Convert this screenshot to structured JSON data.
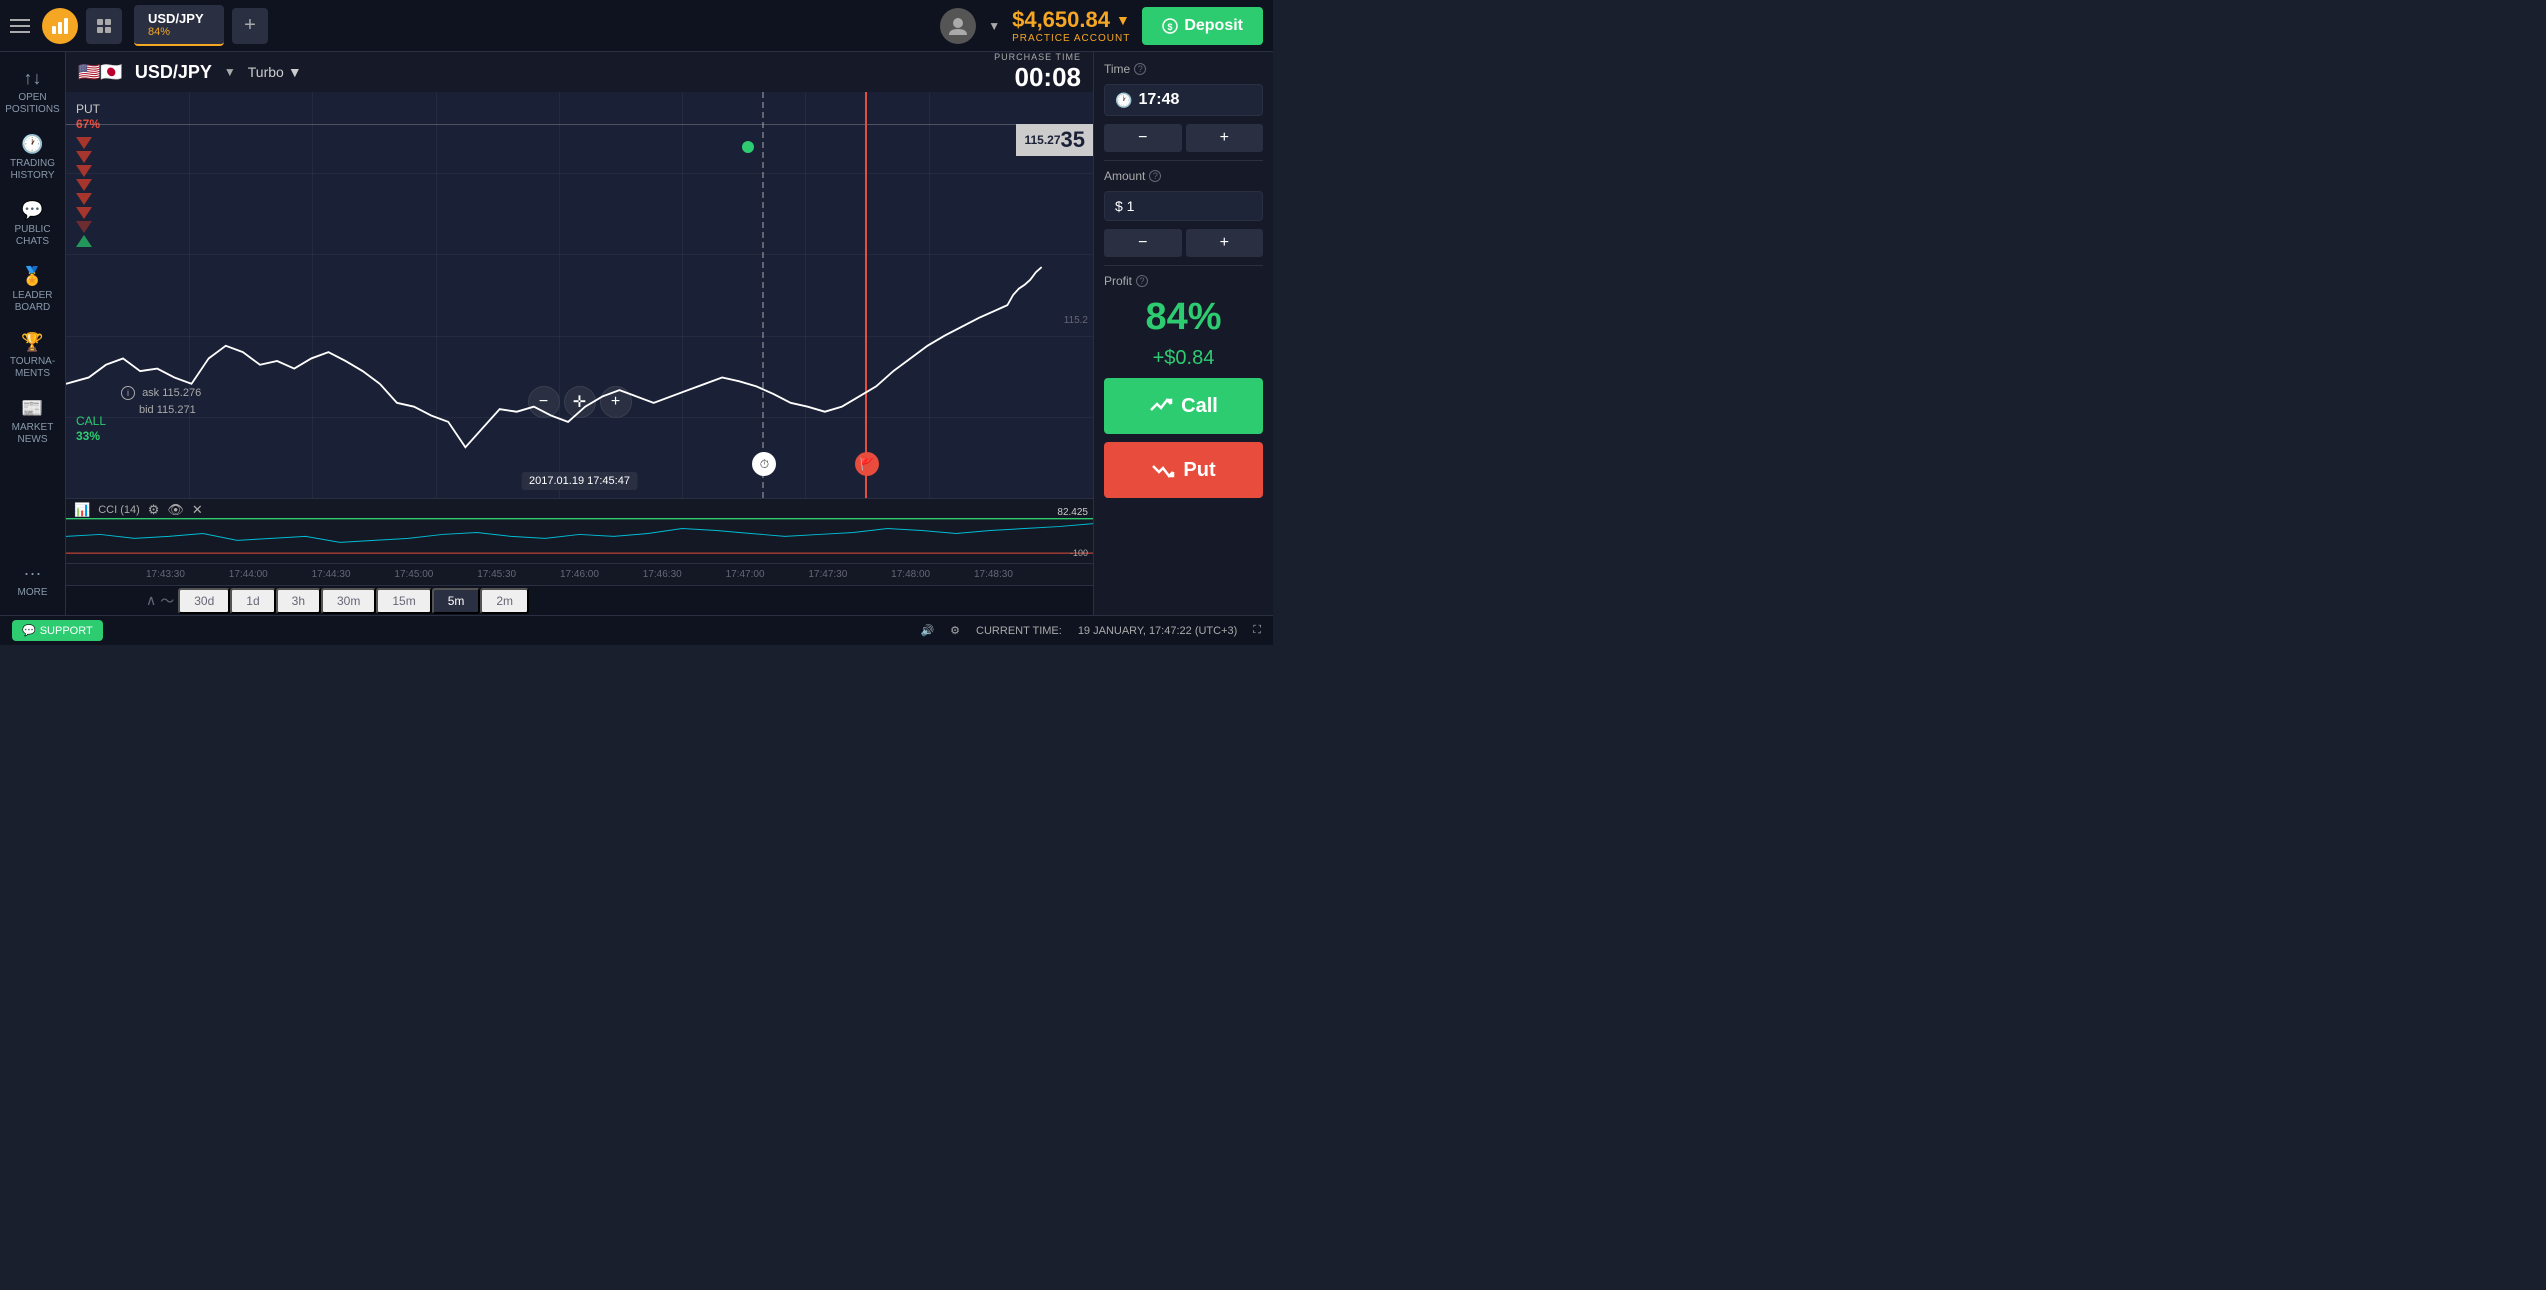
{
  "topnav": {
    "logo_alt": "IQ Option Logo",
    "pair_tab": {
      "name": "USD/JPY",
      "pct": "84%"
    },
    "add_tab_label": "+",
    "balance": "$4,650.84",
    "balance_arrow": "▼",
    "practice_label": "PRACTICE ACCOUNT",
    "deposit_label": "Deposit"
  },
  "sidebar": {
    "items": [
      {
        "id": "open-positions",
        "icon": "↑↓",
        "label": "OPEN\nPOSITIONS"
      },
      {
        "id": "trading-history",
        "icon": "🕐",
        "label": "TRADING\nHISTORY"
      },
      {
        "id": "public-chats",
        "icon": "💬",
        "label": "PUBLIC\nCHATS"
      },
      {
        "id": "leaderboard",
        "icon": "🏅",
        "label": "LEADER\nBOARD"
      },
      {
        "id": "tournaments",
        "icon": "🏆",
        "label": "TOURNA-\nMENTS"
      },
      {
        "id": "market-news",
        "icon": "📰",
        "label": "MARKET\nNEWS"
      },
      {
        "id": "more",
        "icon": "···",
        "label": "MORE"
      }
    ]
  },
  "chart": {
    "pair": "USD/JPY",
    "trade_type": "Turbo",
    "put_label": "PUT",
    "put_pct": "67%",
    "call_label": "CALL",
    "call_pct": "33%",
    "purchase_time_label": "PURCHASE TIME",
    "countdown": "00:08",
    "ask": "115.276",
    "bid": "115.271",
    "price_display": "115.27",
    "price_big": "35",
    "price_115_2": "115.2",
    "date_tooltip": "2017.01.19 17:45:47",
    "cci_label": "CCI (14)",
    "cci_value": "82.425",
    "cci_neg": "-100",
    "time_axis": [
      "17:43:30",
      "17:44:00",
      "17:44:30",
      "17:45:00",
      "17:45:30",
      "17:46:00",
      "17:46:30",
      "17:47:00",
      "17:47:30",
      "17:48:00",
      "17:48:30"
    ]
  },
  "timeframes": {
    "items": [
      "30d",
      "1d",
      "3h",
      "30m",
      "15m",
      "5m",
      "2m"
    ],
    "active": "5m"
  },
  "right_panel": {
    "time_label": "Time",
    "time_value": "17:48",
    "minus": "−",
    "plus": "+",
    "amount_label": "Amount",
    "amount_value": "$ 1",
    "profit_label": "Profit",
    "profit_pct": "84%",
    "profit_dollar": "+$0.84",
    "call_btn": "Call",
    "put_btn": "Put"
  },
  "status_bar": {
    "support_label": "SUPPORT",
    "current_time_label": "CURRENT TIME:",
    "current_time_value": "19 JANUARY, 17:47:22 (UTC+3)"
  }
}
